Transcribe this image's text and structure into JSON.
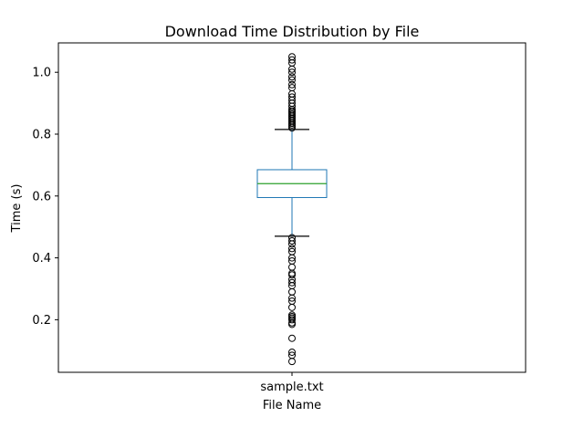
{
  "chart_data": {
    "type": "boxplot",
    "title": "Download Time Distribution by File",
    "xlabel": "File Name",
    "ylabel": "Time (s)",
    "ylim": [
      0.03,
      1.095
    ],
    "yticks": [
      0.2,
      0.4,
      0.6,
      0.8,
      1.0
    ],
    "ytick_labels": [
      "0.2",
      "0.4",
      "0.6",
      "0.8",
      "1.0"
    ],
    "grid": false,
    "categories": [
      "sample.txt"
    ],
    "boxes": [
      {
        "name": "sample.txt",
        "whisker_low": 0.47,
        "q1": 0.595,
        "median": 0.64,
        "q3": 0.685,
        "whisker_high": 0.815,
        "outliers": [
          0.065,
          0.085,
          0.095,
          0.14,
          0.185,
          0.19,
          0.2,
          0.205,
          0.21,
          0.215,
          0.24,
          0.26,
          0.27,
          0.29,
          0.31,
          0.32,
          0.33,
          0.345,
          0.35,
          0.37,
          0.39,
          0.4,
          0.42,
          0.43,
          0.445,
          0.455,
          0.465,
          0.82,
          0.825,
          0.83,
          0.835,
          0.84,
          0.845,
          0.85,
          0.855,
          0.86,
          0.865,
          0.87,
          0.875,
          0.88,
          0.89,
          0.9,
          0.91,
          0.92,
          0.93,
          0.95,
          0.96,
          0.975,
          0.985,
          1.0,
          1.01,
          1.03,
          1.04,
          1.05
        ]
      }
    ],
    "colors": {
      "box": "#1f77b4",
      "median": "#2ca02c",
      "caps": "#000000",
      "outlier": "#000000"
    }
  }
}
